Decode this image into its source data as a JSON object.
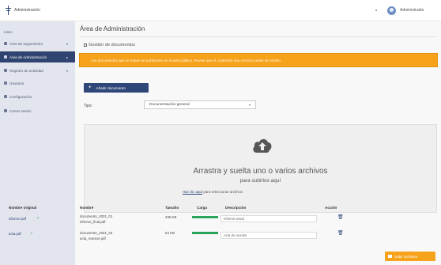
{
  "header": {
    "app_name": "Administración",
    "user_name": "Administrador"
  },
  "sidebar": {
    "items": [
      {
        "label": "Inicio",
        "icon": "home-icon",
        "active": false
      },
      {
        "label": "Área de seguimiento",
        "icon": "chart-icon",
        "active": false,
        "caret": "▾"
      },
      {
        "label": "Área de Administración",
        "icon": "cog-icon",
        "active": true,
        "caret": "▸"
      },
      {
        "label": "Registro de actividad",
        "icon": "list-icon",
        "active": false,
        "caret": "▾"
      },
      {
        "label": "Usuarios",
        "icon": "user-icon",
        "active": false
      },
      {
        "label": "Configuración",
        "icon": "settings-icon",
        "active": false
      },
      {
        "label": "Cerrar sesión",
        "icon": "logout-icon",
        "active": false
      }
    ]
  },
  "main": {
    "title": "Área de Administración",
    "section": "Gestión de documentos",
    "warning": "Los documentos que se suban se publicarán en la web pública. Revise que el contenido sea correcto antes de subirlo.",
    "add_button": "Añadir documento",
    "type_label": "Tipo:",
    "type_value": "Documentación general",
    "dropzone": {
      "title": "Arrastra y suelta uno o varios archivos",
      "subtitle": "para subirlos aquí",
      "link_lead": "Haz clic aquí",
      "link_rest": "para seleccionar archivos"
    },
    "table": {
      "headers": [
        "Nombre original",
        "Nombre",
        "Tamaño",
        "Carga",
        "Descripción",
        "Acción"
      ],
      "rows": [
        {
          "original": "informe.pdf",
          "name_line1": "documento_2021_01",
          "name_line2": "informe_final.pdf",
          "size": "236 KB",
          "progress": 1.0,
          "description": "Informe anual"
        },
        {
          "original": "acta.pdf",
          "name_line1": "documento_2021_02",
          "name_line2": "acta_reunion.pdf",
          "size": "54 KB",
          "progress": 1.0,
          "description": "Acta de reunión"
        }
      ],
      "delete_icon": "🗑"
    },
    "upload_button": "Subir archivos"
  },
  "colors": {
    "sidebar_bg": "#e3e5ee",
    "sidebar_active": "#2f4470",
    "primary": "#2f4678",
    "warning": "#f6a21b",
    "success": "#28a55a"
  }
}
